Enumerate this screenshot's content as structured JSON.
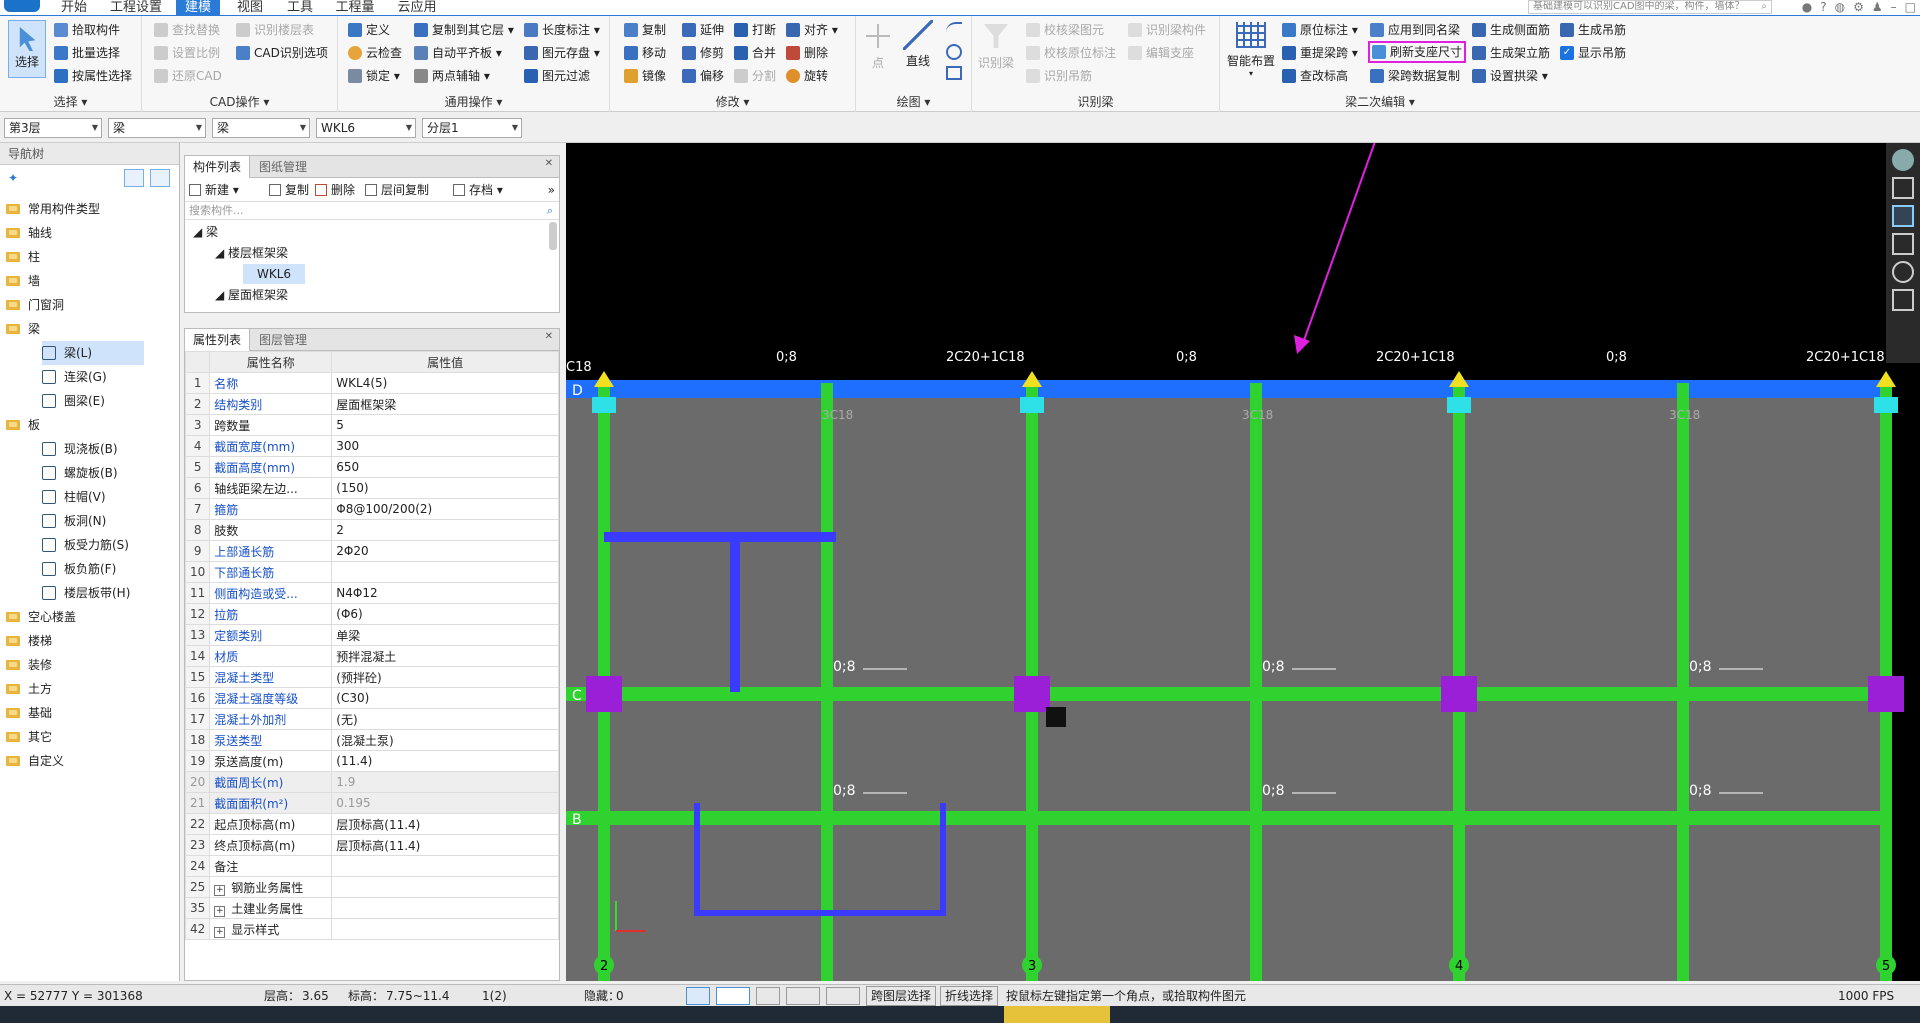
{
  "menu": {
    "tabs": [
      "开始",
      "工程设置",
      "建模",
      "视图",
      "工具",
      "工程量",
      "云应用"
    ],
    "active_tab": "建模",
    "search_placeholder": "基础建模可以识别CAD图中的梁，构件，墙体？",
    "window_icons": [
      "user-icon",
      "help-icon",
      "message-icon",
      "settings-icon",
      "shirt-icon",
      "minimize-icon",
      "maximize-icon"
    ]
  },
  "ribbon": {
    "select_group": {
      "label": "选择",
      "big_button": "选择",
      "items": [
        "拾取构件",
        "批量选择",
        "按属性选择"
      ]
    },
    "cad_group": {
      "label": "CAD操作",
      "items": [
        "查找替换",
        "设置比例",
        "还原CAD",
        "识别楼层表",
        "CAD识别选项"
      ]
    },
    "general_group": {
      "label": "通用操作",
      "items": [
        "定义",
        "云检查",
        "锁定",
        "复制到其它层",
        "自动平齐板",
        "两点辅轴",
        "长度标注",
        "图元存盘",
        "图元过滤"
      ]
    },
    "modify_group": {
      "label": "修改",
      "items": [
        "复制",
        "移动",
        "镜像",
        "延伸",
        "修剪",
        "偏移",
        "打断",
        "合并",
        "分割",
        "对齐",
        "删除",
        "旋转"
      ]
    },
    "draw_group": {
      "label": "绘图",
      "items": [
        "点",
        "直线"
      ]
    },
    "recognize_group": {
      "label": "识别梁",
      "items": [
        "识别梁",
        "校核梁图元",
        "校核原位标注",
        "识别吊筋",
        "识别梁构件",
        "编辑支座"
      ]
    },
    "beam_edit_group": {
      "label": "梁二次编辑",
      "items": [
        "智能布置",
        "原位标注",
        "重提梁跨",
        "查改标高",
        "应用到同名梁",
        "刷新支座尺寸",
        "梁跨数据复制",
        "生成侧面筋",
        "生成架立筋",
        "设置拱梁",
        "生成吊筋",
        "显示吊筋"
      ]
    },
    "highlighted_button": "刷新支座尺寸"
  },
  "toolbar2": {
    "combos": [
      {
        "name": "floor",
        "value": "第3层"
      },
      {
        "name": "category",
        "value": "梁"
      },
      {
        "name": "type",
        "value": "梁"
      },
      {
        "name": "component",
        "value": "WKL6"
      },
      {
        "name": "layer",
        "value": "分层1"
      }
    ]
  },
  "nav": {
    "title": "导航树",
    "items": [
      {
        "label": "常用构件类型",
        "kind": "folder"
      },
      {
        "label": "轴线",
        "kind": "folder"
      },
      {
        "label": "柱",
        "kind": "folder"
      },
      {
        "label": "墙",
        "kind": "folder"
      },
      {
        "label": "门窗洞",
        "kind": "folder"
      },
      {
        "label": "梁",
        "kind": "folder"
      },
      {
        "label": "梁(L)",
        "kind": "sub",
        "selected": true
      },
      {
        "label": "连梁(G)",
        "kind": "sub"
      },
      {
        "label": "圈梁(E)",
        "kind": "sub"
      },
      {
        "label": "板",
        "kind": "folder"
      },
      {
        "label": "现浇板(B)",
        "kind": "sub"
      },
      {
        "label": "螺旋板(B)",
        "kind": "sub"
      },
      {
        "label": "柱帽(V)",
        "kind": "sub"
      },
      {
        "label": "板洞(N)",
        "kind": "sub"
      },
      {
        "label": "板受力筋(S)",
        "kind": "sub"
      },
      {
        "label": "板负筋(F)",
        "kind": "sub"
      },
      {
        "label": "楼层板带(H)",
        "kind": "sub"
      },
      {
        "label": "空心楼盖",
        "kind": "folder"
      },
      {
        "label": "楼梯",
        "kind": "folder"
      },
      {
        "label": "装修",
        "kind": "folder"
      },
      {
        "label": "土方",
        "kind": "folder"
      },
      {
        "label": "基础",
        "kind": "folder"
      },
      {
        "label": "其它",
        "kind": "folder"
      },
      {
        "label": "自定义",
        "kind": "folder"
      }
    ]
  },
  "component_panel": {
    "tabs": [
      "构件列表",
      "图纸管理"
    ],
    "tools": [
      "新建",
      "复制",
      "删除",
      "层间复制",
      "存档"
    ],
    "search_placeholder": "搜索构件...",
    "tree": [
      {
        "label": "梁",
        "level": 0
      },
      {
        "label": "楼层框架梁",
        "level": 1
      },
      {
        "label": "WKL6",
        "level": 2,
        "selected": true
      },
      {
        "label": "屋面框架梁",
        "level": 1
      }
    ]
  },
  "property_panel": {
    "tabs": [
      "属性列表",
      "图层管理"
    ],
    "headers": [
      "属性名称",
      "属性值"
    ],
    "rows": [
      {
        "n": "1",
        "k": "名称",
        "v": "WKL4(5)",
        "blue": true
      },
      {
        "n": "2",
        "k": "结构类别",
        "v": "屋面框架梁",
        "blue": true
      },
      {
        "n": "3",
        "k": "跨数量",
        "v": "5"
      },
      {
        "n": "4",
        "k": "截面宽度(mm)",
        "v": "300",
        "blue": true
      },
      {
        "n": "5",
        "k": "截面高度(mm)",
        "v": "650",
        "blue": true
      },
      {
        "n": "6",
        "k": "轴线距梁左边...",
        "v": "(150)"
      },
      {
        "n": "7",
        "k": "箍筋",
        "v": "Φ8@100/200(2)",
        "blue": true
      },
      {
        "n": "8",
        "k": "肢数",
        "v": "2"
      },
      {
        "n": "9",
        "k": "上部通长筋",
        "v": "2Φ20",
        "blue": true
      },
      {
        "n": "10",
        "k": "下部通长筋",
        "v": "",
        "blue": true
      },
      {
        "n": "11",
        "k": "侧面构造或受...",
        "v": "N4Φ12",
        "blue": true
      },
      {
        "n": "12",
        "k": "拉筋",
        "v": "(Φ6)",
        "blue": true
      },
      {
        "n": "13",
        "k": "定额类别",
        "v": "单梁",
        "blue": true
      },
      {
        "n": "14",
        "k": "材质",
        "v": "预拌混凝土",
        "blue": true
      },
      {
        "n": "15",
        "k": "混凝土类型",
        "v": "(预拌砼)",
        "blue": true
      },
      {
        "n": "16",
        "k": "混凝土强度等级",
        "v": "(C30)",
        "blue": true
      },
      {
        "n": "17",
        "k": "混凝土外加剂",
        "v": "(无)",
        "blue": true
      },
      {
        "n": "18",
        "k": "泵送类型",
        "v": "(混凝土泵)",
        "blue": true
      },
      {
        "n": "19",
        "k": "泵送高度(m)",
        "v": "(11.4)"
      },
      {
        "n": "20",
        "k": "截面周长(m)",
        "v": "1.9",
        "gray": true,
        "blue": true
      },
      {
        "n": "21",
        "k": "截面面积(m²)",
        "v": "0.195",
        "gray": true,
        "blue": true
      },
      {
        "n": "22",
        "k": "起点顶标高(m)",
        "v": "层顶标高(11.4)"
      },
      {
        "n": "23",
        "k": "终点顶标高(m)",
        "v": "层顶标高(11.4)"
      },
      {
        "n": "24",
        "k": "备注",
        "v": ""
      },
      {
        "n": "25",
        "k": "钢筋业务属性",
        "v": "",
        "expand": true
      },
      {
        "n": "35",
        "k": "土建业务属性",
        "v": "",
        "expand": true
      },
      {
        "n": "42",
        "k": "显示样式",
        "v": "",
        "expand": true
      }
    ]
  },
  "canvas": {
    "top_labels": [
      "C18",
      "0;8",
      "2C20+1C18",
      "0;8",
      "2C20+1C18",
      "0;8",
      "2C20+1C18"
    ],
    "span_labels": [
      "3C18",
      "3C18",
      "3C18"
    ],
    "row_labels": [
      "0;8"
    ],
    "axis_labels_left": [
      "D",
      "C",
      "B"
    ],
    "axis_labels_bottom": [
      "2",
      "3",
      "4",
      "5"
    ],
    "colors": {
      "background": "#000000",
      "slab": "#6b6b6b",
      "beam": "#2fd22f",
      "top_beam": "#1f6fff",
      "column": "#9a1fd6",
      "support": "#f0e020",
      "highlight": "#e020e0"
    }
  },
  "status": {
    "coords": "X = 52777 Y = 301368",
    "floor_height_label": "层高：",
    "floor_height": "3.65",
    "elevation_label": "标高：",
    "elevation": "7.75~11.4",
    "page": "1(2)",
    "hidden_label": "隐藏：",
    "hidden": "0",
    "btn_cross_layer": "跨图层选择",
    "btn_polyline": "折线选择",
    "hint": "按鼠标左键指定第一个角点，或拾取构件图元",
    "fps": "1000 FPS"
  }
}
